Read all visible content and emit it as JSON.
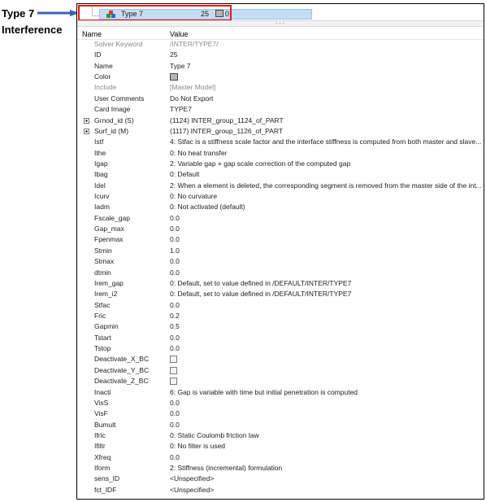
{
  "annotation": {
    "line1": "Type 7",
    "line2": "Interference"
  },
  "top_row": {
    "name": "Type 7",
    "id": "25",
    "value": "0",
    "color": "#b4b4b4"
  },
  "header": {
    "name": "Name",
    "value": "Value"
  },
  "rows": [
    {
      "name": "Solver Keyword",
      "value": "/INTER/TYPE7/",
      "gray": true
    },
    {
      "name": "ID",
      "value": "25"
    },
    {
      "name": "Name",
      "value": "Type 7"
    },
    {
      "name": "Color",
      "value": "",
      "kind": "color"
    },
    {
      "name": "Include",
      "value": "[Master Model]",
      "gray": true
    },
    {
      "name": "User Comments",
      "value": "Do Not Export"
    },
    {
      "name": "Card Image",
      "value": "TYPE7"
    },
    {
      "name": "Grnod_id (S)",
      "value": "(1124) INTER_group_1124_of_PART",
      "expand": true
    },
    {
      "name": "Surf_id (M)",
      "value": "(1117) INTER_group_1126_of_PART",
      "expand": true
    },
    {
      "name": "Istf",
      "value": "4: Stfac is a stiffness scale factor and the interface stiffness is computed from both master and slave..."
    },
    {
      "name": "Ithe",
      "value": "0: No heat transfer"
    },
    {
      "name": "Igap",
      "value": "2: Variable gap + gap scale correction of the computed gap"
    },
    {
      "name": "Ibag",
      "value": "0: Default"
    },
    {
      "name": "Idel",
      "value": "2: When a element is deleted, the corresponding segment is removed from the master side of the int..."
    },
    {
      "name": "Icurv",
      "value": "0: No curvature"
    },
    {
      "name": "Iadm",
      "value": "0: Not activated (default)"
    },
    {
      "name": "Fscale_gap",
      "value": "0.0"
    },
    {
      "name": "Gap_max",
      "value": "0.0"
    },
    {
      "name": "Fpenmax",
      "value": "0.0"
    },
    {
      "name": "Stmin",
      "value": "1.0"
    },
    {
      "name": "Stmax",
      "value": "0.0"
    },
    {
      "name": "dtmin",
      "value": "0.0"
    },
    {
      "name": "Irem_gap",
      "value": "0: Default, set to value defined in /DEFAULT/INTER/TYPE7"
    },
    {
      "name": "Irem_i2",
      "value": "0: Default, set to value defined in /DEFAULT/INTER/TYPE7"
    },
    {
      "name": "Stfac",
      "value": "0.0"
    },
    {
      "name": "Fric",
      "value": "0.2"
    },
    {
      "name": "Gapmin",
      "value": "0.5"
    },
    {
      "name": "Tstart",
      "value": "0.0"
    },
    {
      "name": "Tstop",
      "value": "0.0"
    },
    {
      "name": "Deactivate_X_BC",
      "value": "",
      "kind": "checkbox"
    },
    {
      "name": "Deactivate_Y_BC",
      "value": "",
      "kind": "checkbox"
    },
    {
      "name": "Deactivate_Z_BC",
      "value": "",
      "kind": "checkbox"
    },
    {
      "name": "Inacti",
      "value": "6: Gap is variable with time but initial penetration is computed"
    },
    {
      "name": "VisS",
      "value": "0.0"
    },
    {
      "name": "VisF",
      "value": "0.0"
    },
    {
      "name": "Bumult",
      "value": "0.0"
    },
    {
      "name": "Ifric",
      "value": "0: Static Coulomb friction law"
    },
    {
      "name": "Ifiltr",
      "value": "0: No filter is used"
    },
    {
      "name": "Xfreq",
      "value": "0.0"
    },
    {
      "name": "Iform",
      "value": "2: Stiffness (incremental) formulation"
    },
    {
      "name": "sens_ID",
      "value": "<Unspecified>"
    },
    {
      "name": "fct_IDF",
      "value": "<Unspecified>"
    }
  ]
}
